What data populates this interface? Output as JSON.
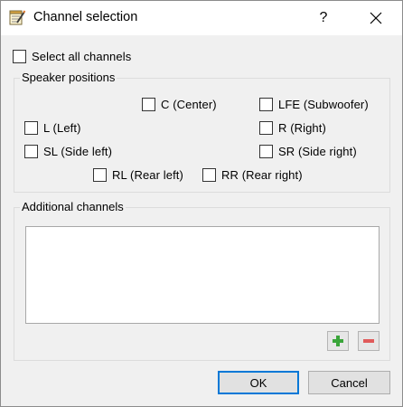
{
  "window": {
    "title": "Channel selection",
    "help_glyph": "?",
    "close_glyph": "✕"
  },
  "select_all": {
    "label": "Select all channels",
    "checked": false
  },
  "speaker_positions": {
    "title": "Speaker positions",
    "channels": {
      "center": {
        "label": "C (Center)",
        "checked": false
      },
      "lfe": {
        "label": "LFE (Subwoofer)",
        "checked": false
      },
      "left": {
        "label": "L (Left)",
        "checked": false
      },
      "right": {
        "label": "R (Right)",
        "checked": false
      },
      "side_left": {
        "label": "SL (Side left)",
        "checked": false
      },
      "side_right": {
        "label": "SR (Side right)",
        "checked": false
      },
      "rear_left": {
        "label": "RL (Rear left)",
        "checked": false
      },
      "rear_right": {
        "label": "RR (Rear right)",
        "checked": false
      }
    }
  },
  "additional_channels": {
    "title": "Additional channels",
    "items": [],
    "add_icon": "plus-icon",
    "remove_icon": "minus-icon"
  },
  "buttons": {
    "ok": "OK",
    "cancel": "Cancel"
  },
  "colors": {
    "add": "#3aa53a",
    "remove": "#e05a5a",
    "focus": "#0078d7"
  }
}
